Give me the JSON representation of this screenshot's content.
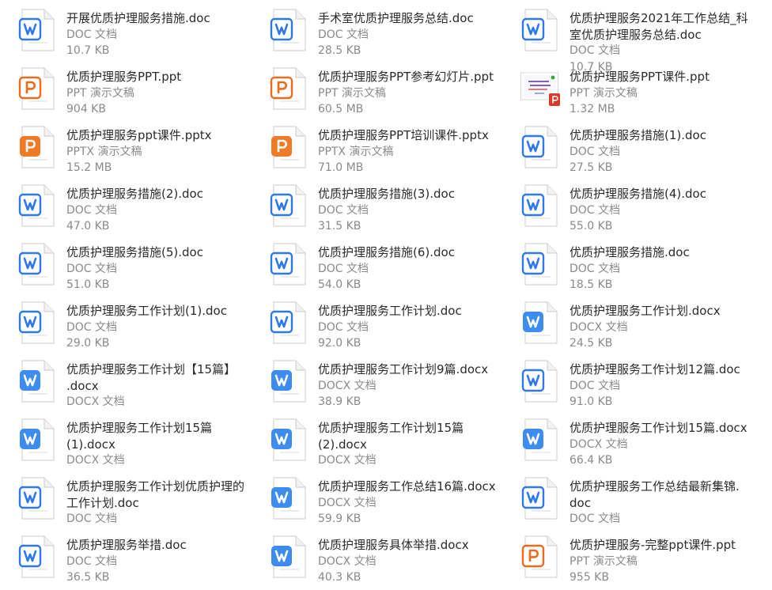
{
  "files": [
    {
      "name": "开展优质护理服务措施.doc",
      "type_label": "DOC 文档",
      "size": "10.7 KB",
      "icon": "word-doc-icon"
    },
    {
      "name": "手术室优质护理服务总结.doc",
      "type_label": "DOC 文档",
      "size": "28.5 KB",
      "icon": "word-doc-icon"
    },
    {
      "name": "优质护理服务2021年工作总结_科室优质护理服务总结.doc",
      "type_label": "DOC 文档",
      "size": "10.7 KB",
      "icon": "word-doc-icon"
    },
    {
      "name": "优质护理服务PPT.ppt",
      "type_label": "PPT 演示文稿",
      "size": "904 KB",
      "icon": "ppt-icon"
    },
    {
      "name": "优质护理服务PPT参考幻灯片.ppt",
      "type_label": "PPT 演示文稿",
      "size": "60.5 MB",
      "icon": "ppt-icon"
    },
    {
      "name": "优质护理服务PPT课件.ppt",
      "type_label": "PPT 演示文稿",
      "size": "1.32 MB",
      "icon": "ppt-thumbnail-icon"
    },
    {
      "name": "优质护理服务ppt课件.pptx",
      "type_label": "PPTX 演示文稿",
      "size": "15.2 MB",
      "icon": "pptx-icon"
    },
    {
      "name": "优质护理服务PPT培训课件.pptx",
      "type_label": "PPTX 演示文稿",
      "size": "71.0 MB",
      "icon": "pptx-icon"
    },
    {
      "name": "优质护理服务措施(1).doc",
      "type_label": "DOC 文档",
      "size": "27.5 KB",
      "icon": "word-doc-icon"
    },
    {
      "name": "优质护理服务措施(2).doc",
      "type_label": "DOC 文档",
      "size": "47.0 KB",
      "icon": "word-doc-icon"
    },
    {
      "name": "优质护理服务措施(3).doc",
      "type_label": "DOC 文档",
      "size": "31.5 KB",
      "icon": "word-doc-icon"
    },
    {
      "name": "优质护理服务措施(4).doc",
      "type_label": "DOC 文档",
      "size": "55.0 KB",
      "icon": "word-doc-icon"
    },
    {
      "name": "优质护理服务措施(5).doc",
      "type_label": "DOC 文档",
      "size": "51.0 KB",
      "icon": "word-doc-icon"
    },
    {
      "name": "优质护理服务措施(6).doc",
      "type_label": "DOC 文档",
      "size": "54.0 KB",
      "icon": "word-doc-icon"
    },
    {
      "name": "优质护理服务措施.doc",
      "type_label": "DOC 文档",
      "size": "18.5 KB",
      "icon": "word-doc-icon"
    },
    {
      "name": "优质护理服务工作计划(1).doc",
      "type_label": "DOC 文档",
      "size": "29.0 KB",
      "icon": "word-doc-icon"
    },
    {
      "name": "优质护理服务工作计划.doc",
      "type_label": "DOC 文档",
      "size": "92.0 KB",
      "icon": "word-doc-icon"
    },
    {
      "name": "优质护理服务工作计划.docx",
      "type_label": "DOCX 文档",
      "size": "24.5 KB",
      "icon": "word-docx-icon"
    },
    {
      "name": "优质护理服务工作计划【15篇】.docx",
      "type_label": "DOCX 文档",
      "size": "",
      "icon": "word-docx-icon"
    },
    {
      "name": "优质护理服务工作计划9篇.docx",
      "type_label": "DOCX 文档",
      "size": "38.9 KB",
      "icon": "word-docx-icon"
    },
    {
      "name": "优质护理服务工作计划12篇.doc",
      "type_label": "DOC 文档",
      "size": "91.0 KB",
      "icon": "word-doc-icon"
    },
    {
      "name": "优质护理服务工作计划15篇(1).docx",
      "type_label": "DOCX 文档",
      "size": "",
      "icon": "word-docx-icon"
    },
    {
      "name": "优质护理服务工作计划15篇(2).docx",
      "type_label": "DOCX 文档",
      "size": "",
      "icon": "word-docx-icon"
    },
    {
      "name": "优质护理服务工作计划15篇.docx",
      "type_label": "DOCX 文档",
      "size": "66.4 KB",
      "icon": "word-docx-icon"
    },
    {
      "name": "优质护理服务工作计划优质护理的工作计划.doc",
      "type_label": "DOC 文档",
      "size": "",
      "icon": "word-doc-icon"
    },
    {
      "name": "优质护理服务工作总结16篇.docx",
      "type_label": "DOCX 文档",
      "size": "59.9 KB",
      "icon": "word-docx-icon"
    },
    {
      "name": "优质护理服务工作总结最新集锦.doc",
      "type_label": "DOC 文档",
      "size": "",
      "icon": "word-doc-icon"
    },
    {
      "name": "优质护理服务举措.doc",
      "type_label": "DOC 文档",
      "size": "36.5 KB",
      "icon": "word-doc-icon"
    },
    {
      "name": "优质护理服务具体举措.docx",
      "type_label": "DOCX 文档",
      "size": "40.3 KB",
      "icon": "word-docx-icon"
    },
    {
      "name": "优质护理服务-完整ppt课件.ppt",
      "type_label": "PPT 演示文稿",
      "size": "955 KB",
      "icon": "ppt-icon"
    }
  ],
  "colors": {
    "word_blue": "#2d78ea",
    "word_blue_light": "#3d8cf0",
    "ppt_orange": "#f06a1d",
    "pptx_orange": "#f07a26",
    "meta_gray": "#8a8a8a",
    "name_dark": "#2a2a2a"
  }
}
